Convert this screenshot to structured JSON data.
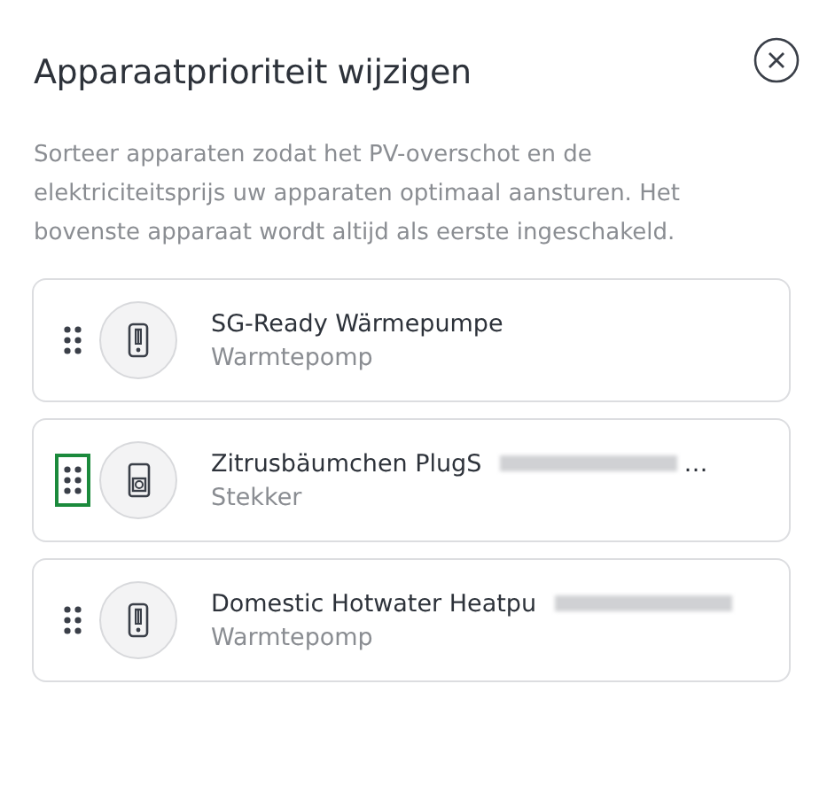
{
  "dialog": {
    "title": "Apparaatprioriteit wijzigen",
    "description": "Sorteer apparaten zodat het PV-overschot en de elektriciteitsprijs uw apparaten optimaal aansturen. Het bovenste apparaat wordt altijd als eerste ingeschakeld."
  },
  "devices": [
    {
      "kind": "heatpump",
      "name": "SG-Ready Wärmepumpe",
      "type": "Warmtepomp",
      "focused": false,
      "redacted": false
    },
    {
      "kind": "plug",
      "name": "Zitrusbäumchen PlugS",
      "suffix": "…",
      "type": "Stekker",
      "focused": true,
      "redacted": true
    },
    {
      "kind": "heatpump",
      "name": "Domestic Hotwater Heatpu",
      "type": "Warmtepomp",
      "focused": false,
      "redacted": true
    }
  ]
}
